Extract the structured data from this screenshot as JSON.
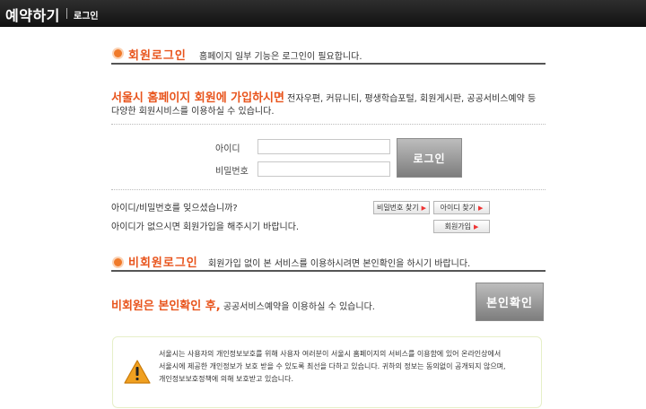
{
  "header": {
    "title": "예약하기",
    "subtitle": "로그인"
  },
  "member_login": {
    "title": "회원로그인",
    "desc": "홈페이지 일부 기능은 로그인이 필요합니다.",
    "highlight": "서울시 홈페이지 회원에 가입하시면",
    "info1": "전자우편, 커뮤니티, 평생학습포털, 회원게시판, 공공서비스예약 등",
    "info2": "다양한 회원시비스를 이용하실 수 있습니다.",
    "id_label": "아이디",
    "pw_label": "비밀번호",
    "login_button": "로그인",
    "forgot_text": "아이디/비밀번호를 잊으셨습니까?",
    "signup_text": "아이디가 없으시면 회원가입을 해주시기 바랍니다.",
    "find_pw_button": "비밀번호 찾기",
    "find_id_button": "아이디 찾기",
    "signup_button": "회원가입"
  },
  "guest_login": {
    "title": "비회원로그인",
    "desc": "회원가입 없이 본 서비스를 이용하시려면 본인확인을 하시기 바랍니다.",
    "highlight": "비회원은 본인확인 후,",
    "info": "공공서비스예약을 이용하실 수 있습니다.",
    "verify_button": "본인확인"
  },
  "notice": {
    "line1": "서울시는 사용자의 개인정보보호를 위해 사용자 여러분이 서울시 홈페이지의 서비스를 이용함에 있어 온라인상에서",
    "line2": "서울시에 제공한 개인정보가 보호 받을 수 있도록 최선을 다하고 있습니다. 귀하의 정보는 동의없이 공개되지 않으며,",
    "line3": "개인정보보호정책에 의해 보호받고 있습니다."
  },
  "colors": {
    "accent": "#e8541c",
    "header_bg": "#1a1a1a",
    "warning": "#f0a020"
  }
}
